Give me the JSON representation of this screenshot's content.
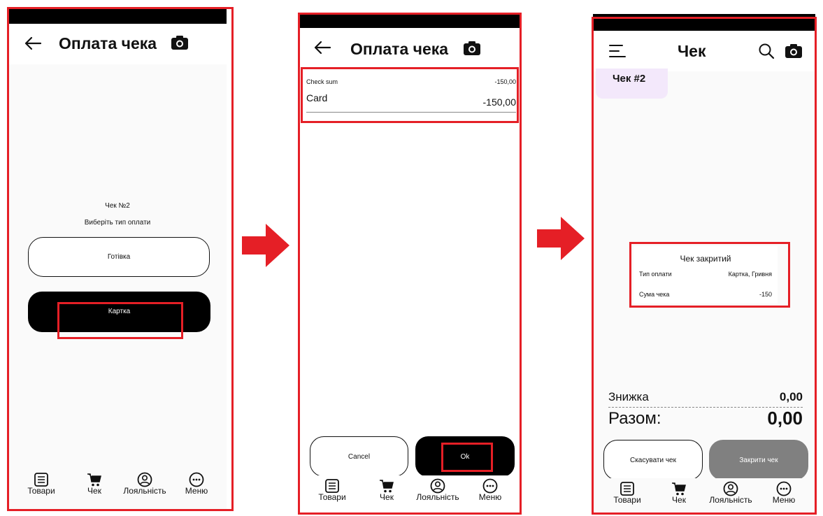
{
  "screen1": {
    "title": "Оплата чека",
    "receipt_label": "Чек №2",
    "prompt": "Виберіть тип оплати",
    "cash_button": "Готівка",
    "card_button": "Картка"
  },
  "screen2": {
    "title": "Оплата чека",
    "check_sum_label": "Check sum",
    "check_sum_value": "-150,00",
    "card_label": "Card",
    "card_value": "-150,00",
    "cancel_button": "Cancel",
    "ok_button": "Ok"
  },
  "screen3": {
    "title": "Чек",
    "tab_chip": "Чек #2",
    "closed_title": "Чек закритий",
    "payment_type_label": "Тип оплати",
    "payment_type_value": "Картка, Гривня",
    "sum_label": "Сума чека",
    "sum_value": "-150",
    "discount_label": "Знижка",
    "discount_value": "0,00",
    "total_label": "Разом:",
    "total_value": "0,00",
    "cancel_receipt_button": "Скасувати чек",
    "close_receipt_button": "Закрити чек"
  },
  "tabbar": {
    "goods": "Товари",
    "receipt": "Чек",
    "loyalty": "Лояльність",
    "menu": "Меню"
  },
  "colors": {
    "highlight": "#e51f26",
    "primary_button": "#000000",
    "disabled_button": "#808080",
    "chip_bg": "#f3e8fb"
  },
  "icons": [
    "back-arrow-icon",
    "camera-icon",
    "hamburger-icon",
    "search-icon",
    "list-icon",
    "cart-icon",
    "user-circle-icon",
    "more-icon",
    "flow-arrow-icon"
  ]
}
